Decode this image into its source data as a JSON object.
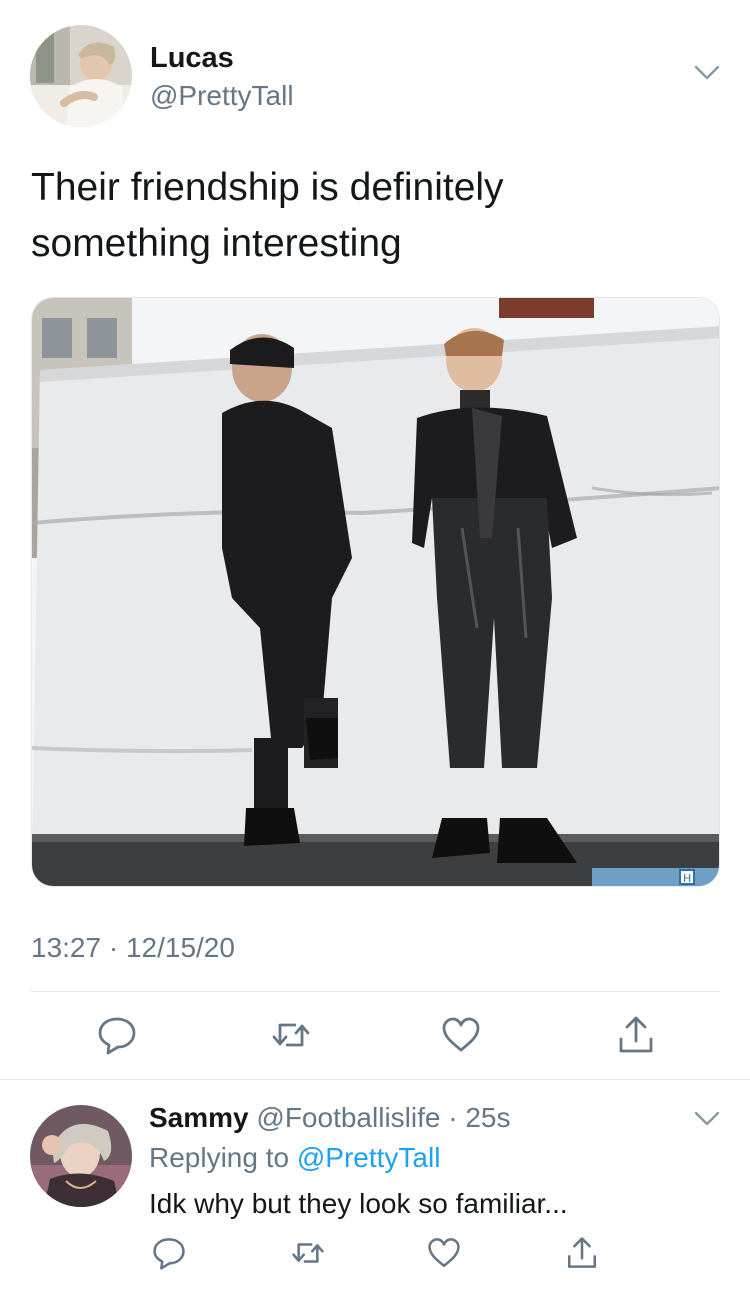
{
  "tweet": {
    "author_name": "Lucas",
    "author_handle": "@PrettyTall",
    "text_line1": "Their friendship is definitely",
    "text_line2": "something interesting",
    "timestamp": "13:27 · 12/15/20",
    "media": {
      "description_icon": "photo",
      "badge_text": "H"
    },
    "actions": [
      {
        "name": "reply",
        "icon": "speech-bubble-icon"
      },
      {
        "name": "retweet",
        "icon": "retweet-icon"
      },
      {
        "name": "like",
        "icon": "heart-icon"
      },
      {
        "name": "share",
        "icon": "share-icon"
      }
    ]
  },
  "reply": {
    "author_name": "Sammy",
    "author_handle": "@Footballislife",
    "separator": " · ",
    "time": "25s",
    "replying_prefix": "Replying to ",
    "replying_to": "@PrettyTall",
    "text": "Idk why but they look so familiar..."
  },
  "colors": {
    "text_primary": "#14171a",
    "text_secondary": "#657786",
    "accent": "#1da1f2",
    "divider": "#e1e8ed"
  }
}
